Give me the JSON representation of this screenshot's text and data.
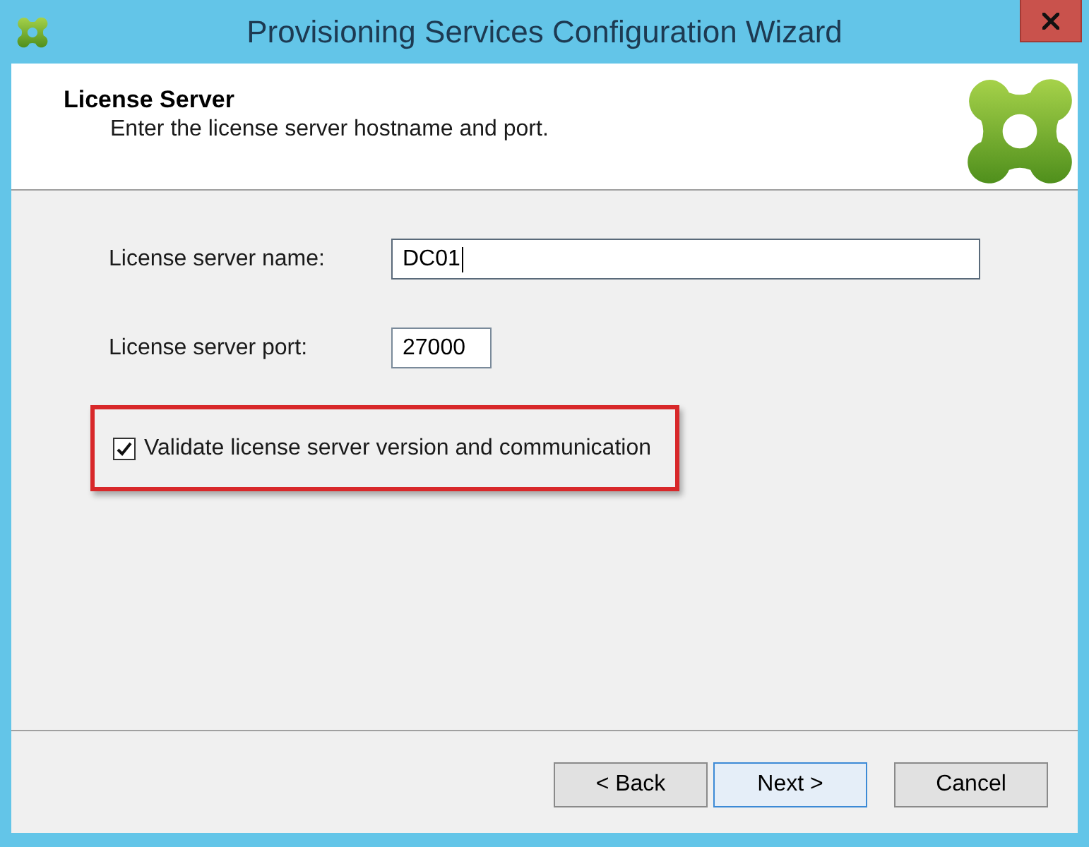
{
  "window": {
    "title": "Provisioning Services Configuration Wizard"
  },
  "header": {
    "title": "License Server",
    "subtitle": "Enter the license server hostname and port."
  },
  "fields": [
    {
      "kind": "text",
      "label": "License server name:",
      "value": "DC01",
      "focused": true
    },
    {
      "kind": "port",
      "label": "License server port:",
      "value": "27000",
      "focused": false
    }
  ],
  "option": {
    "label": "Validate license server version and communication",
    "checked": true,
    "highlighted": true
  },
  "buttons": [
    {
      "label": "< Back",
      "default": false
    },
    {
      "label": "Next >",
      "default": true
    },
    {
      "label": "Cancel",
      "default": false
    }
  ]
}
